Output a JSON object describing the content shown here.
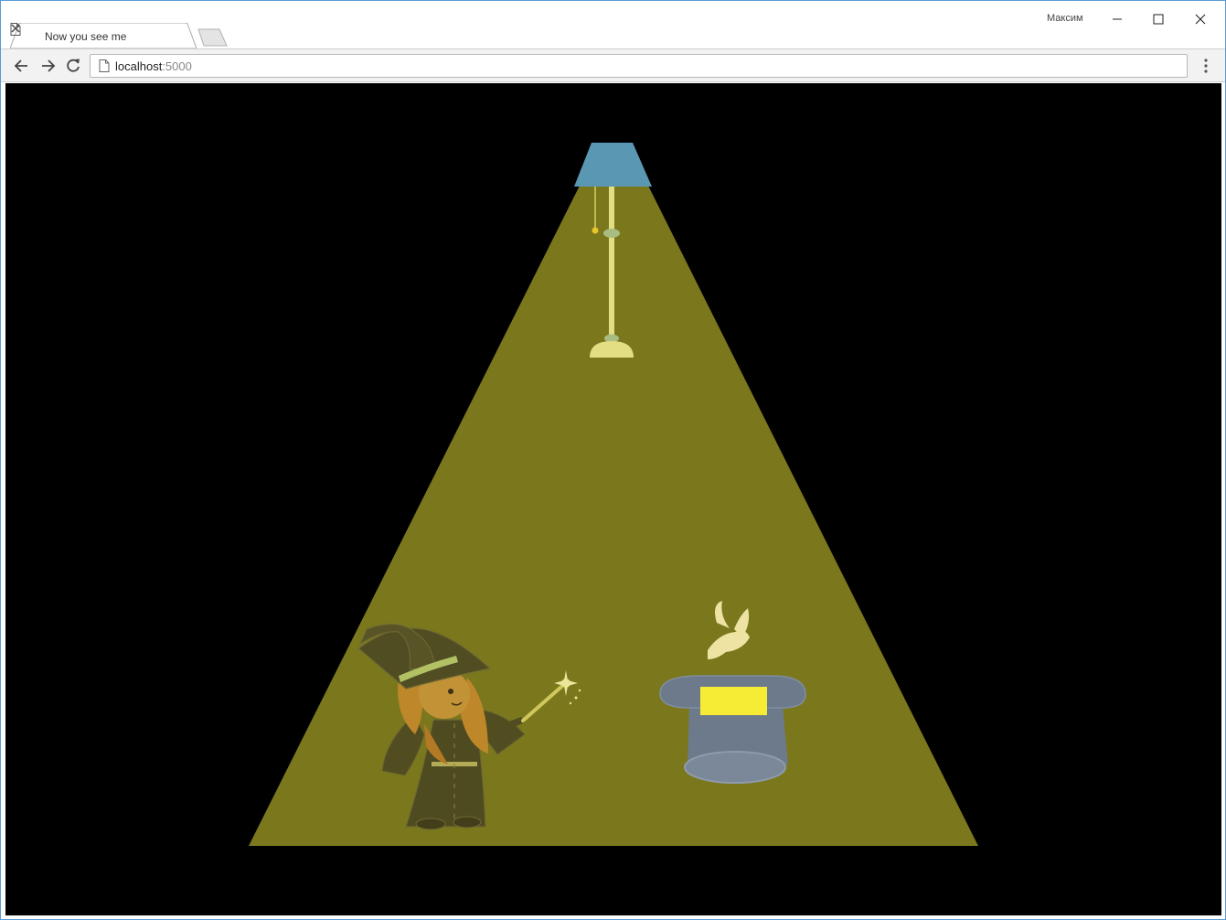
{
  "browser": {
    "tab_title": "Now you see me",
    "profile_name": "Максим",
    "url_host": "localhost",
    "url_port": ":5000"
  },
  "icons": {
    "tab_page": "page-icon",
    "tab_close": "close-icon",
    "back": "arrow-left-icon",
    "forward": "arrow-right-icon",
    "reload": "reload-icon",
    "menu": "kebab-menu-icon"
  },
  "colors": {
    "stage_background": "#000000",
    "light_beam": "#7b771d",
    "lamp_shade": "#5a97b3",
    "lamp_pole": "#e3dd83",
    "hat_body": "#6c7a8c",
    "hat_band": "#f7ec35",
    "dove": "#eee3a2"
  }
}
